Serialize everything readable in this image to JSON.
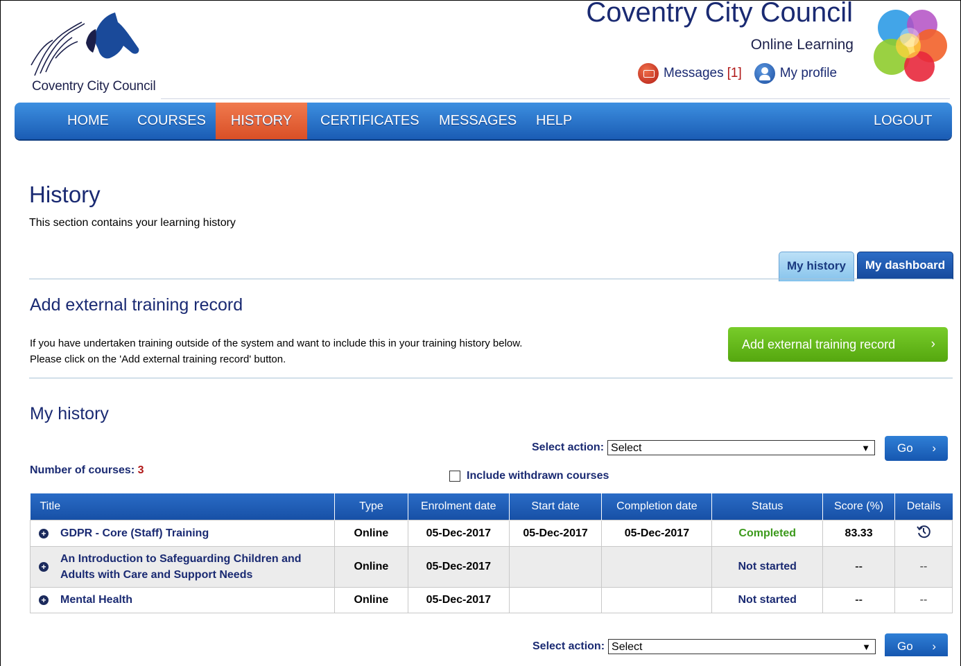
{
  "header": {
    "logo_caption": "Coventry City Council",
    "brand_title": "Coventry City Council",
    "brand_subtitle": "Online Learning",
    "messages_label": "Messages",
    "messages_count": "[1]",
    "profile_label": "My profile"
  },
  "nav": {
    "items": [
      "HOME",
      "COURSES",
      "HISTORY",
      "CERTIFICATES",
      "MESSAGES",
      "HELP"
    ],
    "active": "HISTORY",
    "logout": "LOGOUT"
  },
  "page": {
    "title": "History",
    "intro": "This section contains your learning history"
  },
  "tabs": {
    "history": "My history",
    "dashboard": "My dashboard"
  },
  "external": {
    "heading": "Add external training record",
    "line1": "If you have undertaken training outside of the system and want to include this in your training history below.",
    "line2": "Please click on the 'Add external training record' button.",
    "button": "Add external training record",
    "button_chevron": "›"
  },
  "history": {
    "heading": "My history",
    "select_label": "Select action:",
    "select_value": "Select",
    "go": "Go",
    "go_chevron": "›",
    "count_label": "Number of courses:",
    "count": "3",
    "withdrawn_label": "Include withdrawn courses"
  },
  "table": {
    "columns": [
      "Title",
      "Type",
      "Enrolment date",
      "Start date",
      "Completion date",
      "Status",
      "Score (%)",
      "Details"
    ],
    "rows": [
      {
        "title": "GDPR - Core (Staff) Training",
        "type": "Online",
        "enrolment": "05-Dec-2017",
        "start": "05-Dec-2017",
        "completion": "05-Dec-2017",
        "status": "Completed",
        "score": "83.33",
        "details": "history-icon"
      },
      {
        "title": "An Introduction to Safeguarding Children and Adults with Care and Support Needs",
        "type": "Online",
        "enrolment": "05-Dec-2017",
        "start": "",
        "completion": "",
        "status": "Not started",
        "score": "--",
        "details": "--"
      },
      {
        "title": "Mental Health",
        "type": "Online",
        "enrolment": "05-Dec-2017",
        "start": "",
        "completion": "",
        "status": "Not started",
        "score": "--",
        "details": "--"
      }
    ]
  },
  "colors": {
    "nav_blue": "#1a5cb4",
    "active_tab": "#d94f26",
    "green_button": "#55a70f",
    "heading_navy": "#1a2a72",
    "completed_green": "#3c9a1c"
  }
}
